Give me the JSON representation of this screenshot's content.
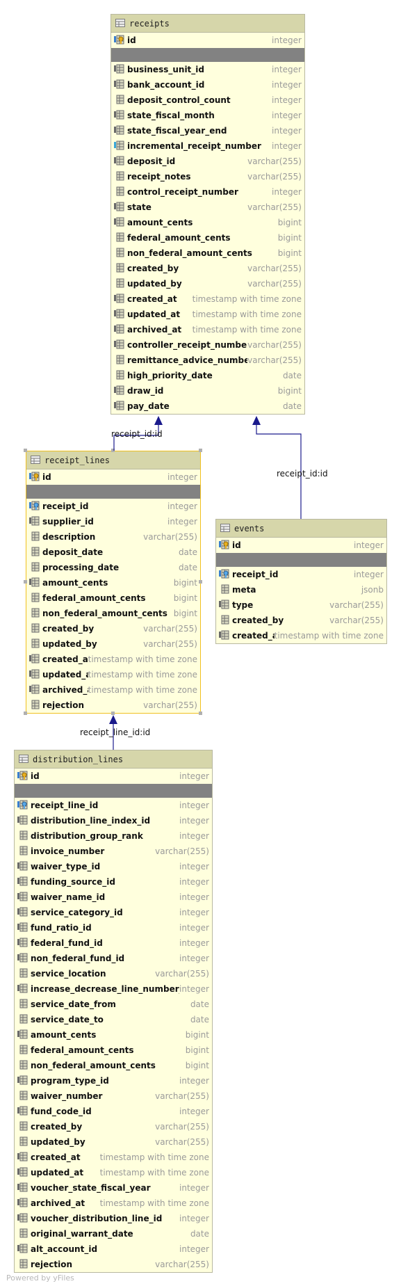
{
  "tables": [
    {
      "id": "receipts",
      "title": "receipts",
      "selected": false,
      "pk": {
        "name": "id",
        "type": "integer"
      },
      "columns": [
        {
          "name": "business_unit_id",
          "type": "integer",
          "icon": "fk"
        },
        {
          "name": "bank_account_id",
          "type": "integer",
          "icon": "fk"
        },
        {
          "name": "deposit_control_count",
          "type": "integer",
          "icon": "col"
        },
        {
          "name": "state_fiscal_month",
          "type": "integer",
          "icon": "fk"
        },
        {
          "name": "state_fiscal_year_end",
          "type": "integer",
          "icon": "fk"
        },
        {
          "name": "incremental_receipt_number",
          "type": "integer",
          "icon": "idx"
        },
        {
          "name": "deposit_id",
          "type": "varchar(255)",
          "icon": "fk"
        },
        {
          "name": "receipt_notes",
          "type": "varchar(255)",
          "icon": "col"
        },
        {
          "name": "control_receipt_number",
          "type": "integer",
          "icon": "col"
        },
        {
          "name": "state",
          "type": "varchar(255)",
          "icon": "fk"
        },
        {
          "name": "amount_cents",
          "type": "bigint",
          "icon": "fk"
        },
        {
          "name": "federal_amount_cents",
          "type": "bigint",
          "icon": "col"
        },
        {
          "name": "non_federal_amount_cents",
          "type": "bigint",
          "icon": "col"
        },
        {
          "name": "created_by",
          "type": "varchar(255)",
          "icon": "col"
        },
        {
          "name": "updated_by",
          "type": "varchar(255)",
          "icon": "col"
        },
        {
          "name": "created_at",
          "type": "timestamp with time zone",
          "icon": "fk"
        },
        {
          "name": "updated_at",
          "type": "timestamp with time zone",
          "icon": "fk"
        },
        {
          "name": "archived_at",
          "type": "timestamp with time zone",
          "icon": "fk"
        },
        {
          "name": "controller_receipt_number",
          "type": "varchar(255)",
          "icon": "fk"
        },
        {
          "name": "remittance_advice_number",
          "type": "varchar(255)",
          "icon": "col"
        },
        {
          "name": "high_priority_date",
          "type": "date",
          "icon": "col"
        },
        {
          "name": "draw_id",
          "type": "bigint",
          "icon": "fk"
        },
        {
          "name": "pay_date",
          "type": "date",
          "icon": "fk"
        }
      ]
    },
    {
      "id": "receipt_lines",
      "title": "receipt_lines",
      "selected": true,
      "pk": {
        "name": "id",
        "type": "integer"
      },
      "columns": [
        {
          "name": "receipt_id",
          "type": "integer",
          "icon": "fkref"
        },
        {
          "name": "supplier_id",
          "type": "integer",
          "icon": "fk"
        },
        {
          "name": "description",
          "type": "varchar(255)",
          "icon": "col"
        },
        {
          "name": "deposit_date",
          "type": "date",
          "icon": "col"
        },
        {
          "name": "processing_date",
          "type": "date",
          "icon": "col"
        },
        {
          "name": "amount_cents",
          "type": "bigint",
          "icon": "fk"
        },
        {
          "name": "federal_amount_cents",
          "type": "bigint",
          "icon": "col"
        },
        {
          "name": "non_federal_amount_cents",
          "type": "bigint",
          "icon": "col"
        },
        {
          "name": "created_by",
          "type": "varchar(255)",
          "icon": "col"
        },
        {
          "name": "updated_by",
          "type": "varchar(255)",
          "icon": "col"
        },
        {
          "name": "created_at",
          "type": "timestamp with time zone",
          "icon": "fk"
        },
        {
          "name": "updated_at",
          "type": "timestamp with time zone",
          "icon": "fk"
        },
        {
          "name": "archived_at",
          "type": "timestamp with time zone",
          "icon": "fk"
        },
        {
          "name": "rejection",
          "type": "varchar(255)",
          "icon": "col"
        }
      ]
    },
    {
      "id": "events",
      "title": "events",
      "selected": false,
      "pk": {
        "name": "id",
        "type": "integer"
      },
      "columns": [
        {
          "name": "receipt_id",
          "type": "integer",
          "icon": "fkref"
        },
        {
          "name": "meta",
          "type": "jsonb",
          "icon": "col"
        },
        {
          "name": "type",
          "type": "varchar(255)",
          "icon": "fk"
        },
        {
          "name": "created_by",
          "type": "varchar(255)",
          "icon": "col"
        },
        {
          "name": "created_at",
          "type": "timestamp with time zone",
          "icon": "fk"
        }
      ]
    },
    {
      "id": "distribution_lines",
      "title": "distribution_lines",
      "selected": false,
      "pk": {
        "name": "id",
        "type": "integer"
      },
      "columns": [
        {
          "name": "receipt_line_id",
          "type": "integer",
          "icon": "fkref"
        },
        {
          "name": "distribution_line_index_id",
          "type": "integer",
          "icon": "fk"
        },
        {
          "name": "distribution_group_rank",
          "type": "integer",
          "icon": "col"
        },
        {
          "name": "invoice_number",
          "type": "varchar(255)",
          "icon": "col"
        },
        {
          "name": "waiver_type_id",
          "type": "integer",
          "icon": "fk"
        },
        {
          "name": "funding_source_id",
          "type": "integer",
          "icon": "fk"
        },
        {
          "name": "waiver_name_id",
          "type": "integer",
          "icon": "fk"
        },
        {
          "name": "service_category_id",
          "type": "integer",
          "icon": "fk"
        },
        {
          "name": "fund_ratio_id",
          "type": "integer",
          "icon": "fk"
        },
        {
          "name": "federal_fund_id",
          "type": "integer",
          "icon": "fk"
        },
        {
          "name": "non_federal_fund_id",
          "type": "integer",
          "icon": "fk"
        },
        {
          "name": "service_location",
          "type": "varchar(255)",
          "icon": "col"
        },
        {
          "name": "increase_decrease_line_number_id",
          "type": "integer",
          "icon": "fk"
        },
        {
          "name": "service_date_from",
          "type": "date",
          "icon": "col"
        },
        {
          "name": "service_date_to",
          "type": "date",
          "icon": "col"
        },
        {
          "name": "amount_cents",
          "type": "bigint",
          "icon": "fk"
        },
        {
          "name": "federal_amount_cents",
          "type": "bigint",
          "icon": "col"
        },
        {
          "name": "non_federal_amount_cents",
          "type": "bigint",
          "icon": "col"
        },
        {
          "name": "program_type_id",
          "type": "integer",
          "icon": "fk"
        },
        {
          "name": "waiver_number",
          "type": "varchar(255)",
          "icon": "col"
        },
        {
          "name": "fund_code_id",
          "type": "integer",
          "icon": "fk"
        },
        {
          "name": "created_by",
          "type": "varchar(255)",
          "icon": "col"
        },
        {
          "name": "updated_by",
          "type": "varchar(255)",
          "icon": "col"
        },
        {
          "name": "created_at",
          "type": "timestamp with time zone",
          "icon": "fk"
        },
        {
          "name": "updated_at",
          "type": "timestamp with time zone",
          "icon": "fk"
        },
        {
          "name": "voucher_state_fiscal_year",
          "type": "integer",
          "icon": "fk"
        },
        {
          "name": "archived_at",
          "type": "timestamp with time zone",
          "icon": "fk"
        },
        {
          "name": "voucher_distribution_line_id",
          "type": "integer",
          "icon": "fk"
        },
        {
          "name": "original_warrant_date",
          "type": "date",
          "icon": "col"
        },
        {
          "name": "alt_account_id",
          "type": "integer",
          "icon": "fk"
        },
        {
          "name": "rejection",
          "type": "varchar(255)",
          "icon": "col"
        }
      ]
    }
  ],
  "edges": [
    {
      "from": "receipt_lines",
      "to": "receipts",
      "label": "receipt_id:id"
    },
    {
      "from": "events",
      "to": "receipts",
      "label": "receipt_id:id"
    },
    {
      "from": "distribution_lines",
      "to": "receipt_lines",
      "label": "receipt_line_id:id"
    }
  ],
  "footer": {
    "powered_by": "Powered by yFiles"
  },
  "colors": {
    "header": "#d6d6aa",
    "body": "#ffffdd",
    "separator": "#828282",
    "edge": "#1a1a8c",
    "selection": "#f0c020"
  }
}
